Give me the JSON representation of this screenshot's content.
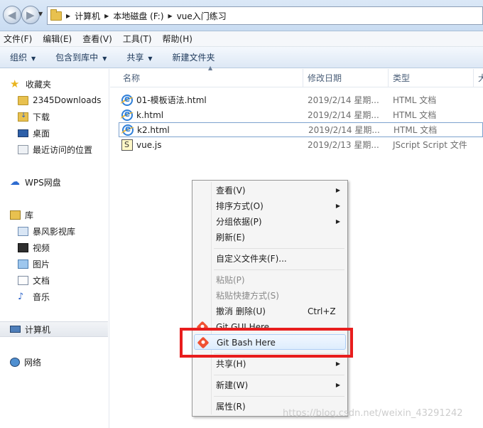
{
  "address": {
    "path": [
      "计算机",
      "本地磁盘 (F:)",
      "vue入门练习"
    ]
  },
  "menubar": [
    "文件(F)",
    "编辑(E)",
    "查看(V)",
    "工具(T)",
    "帮助(H)"
  ],
  "toolbar": {
    "organize": "组织",
    "include": "包含到库中",
    "share": "共享",
    "new_folder": "新建文件夹"
  },
  "sidebar": {
    "favorites": "收藏夹",
    "fav_items": [
      "2345Downloads",
      "下载",
      "桌面",
      "最近访问的位置"
    ],
    "wps": "WPS网盘",
    "library": "库",
    "lib_items": [
      "暴风影视库",
      "视频",
      "图片",
      "文档",
      "音乐"
    ],
    "computer": "计算机",
    "network": "网络"
  },
  "columns": {
    "name": "名称",
    "date": "修改日期",
    "type": "类型",
    "size": "大"
  },
  "files": [
    {
      "name": "01-模板语法.html",
      "date": "2019/2/14 星期...",
      "type": "HTML 文档"
    },
    {
      "name": "k.html",
      "date": "2019/2/14 星期...",
      "type": "HTML 文档"
    },
    {
      "name": "k2.html",
      "date": "2019/2/14 星期...",
      "type": "HTML 文档"
    },
    {
      "name": "vue.js",
      "date": "2019/2/13 星期...",
      "type": "JScript Script 文件"
    }
  ],
  "context_menu": {
    "view": "查看(V)",
    "sort": "排序方式(O)",
    "group": "分组依据(P)",
    "refresh": "刷新(E)",
    "customize": "自定义文件夹(F)...",
    "paste": "粘贴(P)",
    "paste_shortcut": "粘贴快捷方式(S)",
    "undo": "撤消 删除(U)",
    "undo_shortcut": "Ctrl+Z",
    "git_gui": "Git GUI Here",
    "git_bash": "Git Bash Here",
    "share": "共享(H)",
    "new": "新建(W)",
    "properties": "属性(R)"
  },
  "watermark": "https://blog.csdn.net/weixin_43291242",
  "colors": {
    "highlight": "#e81d1d",
    "accent": "#2f7fd8"
  }
}
